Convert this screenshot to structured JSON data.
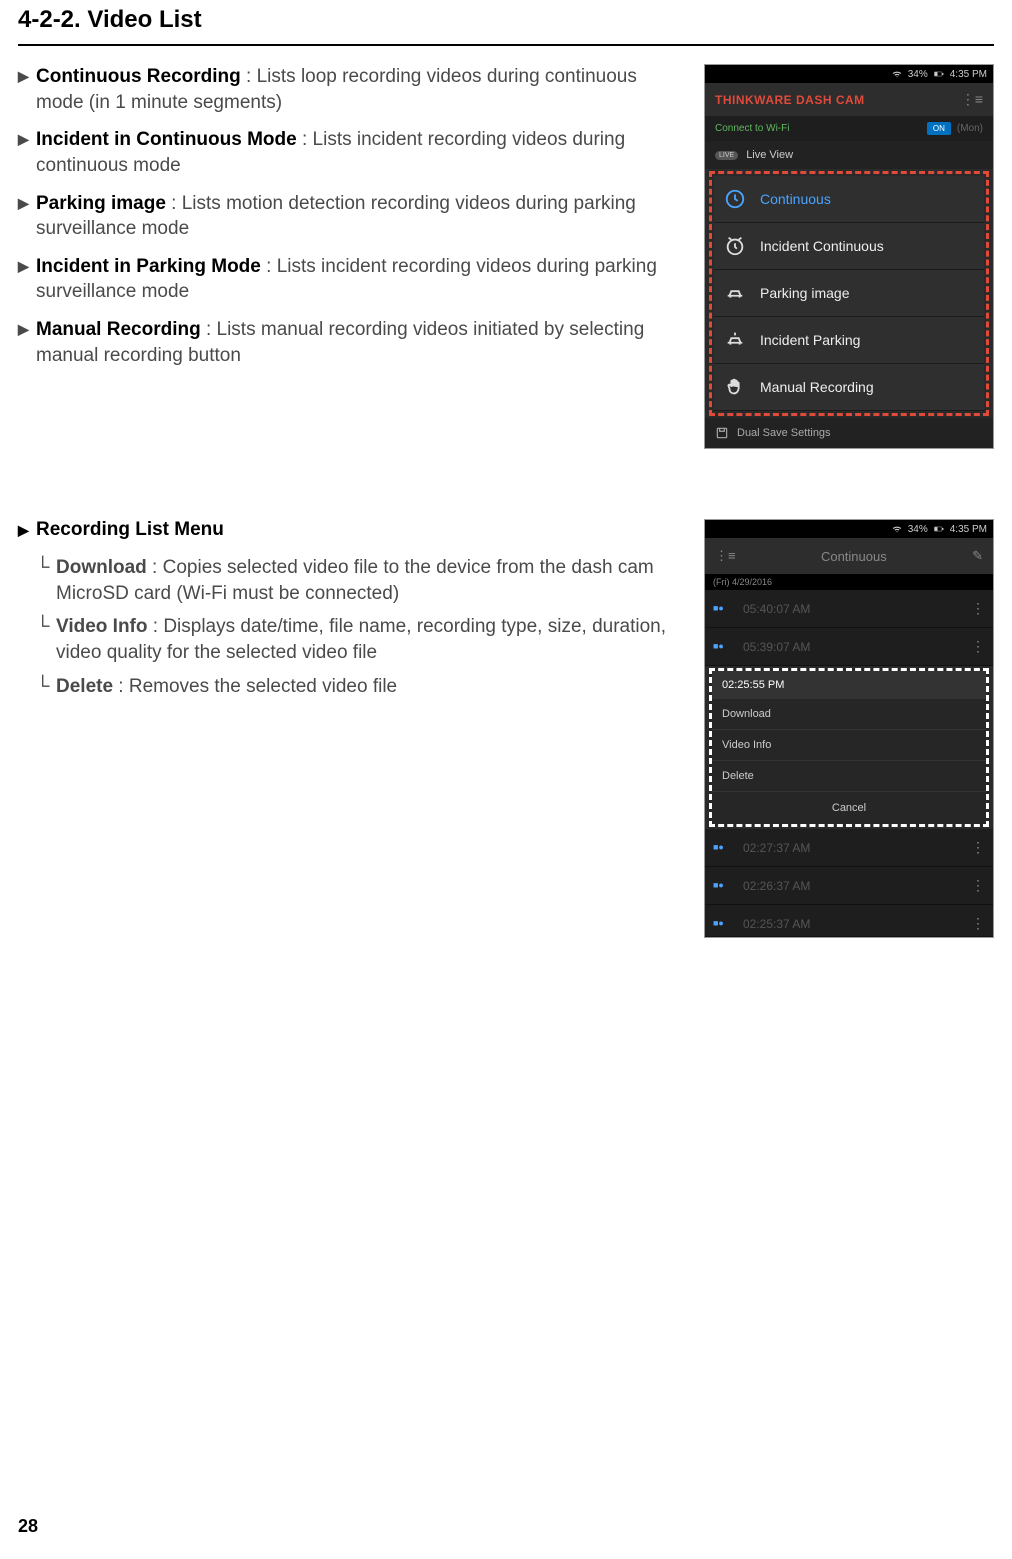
{
  "page": {
    "section_title": "4-2-2. Video List",
    "number": "28"
  },
  "list1": [
    {
      "label": "Continuous Recording",
      "desc": " : Lists loop recording videos during continuous mode (in 1 minute segments)"
    },
    {
      "label": "Incident in Continuous Mode",
      "desc": " : Lists incident recording videos during continuous mode"
    },
    {
      "label": "Parking image",
      "desc": " : Lists motion detection recording videos during parking surveillance mode"
    },
    {
      "label": "Incident in Parking Mode",
      "desc": " : Lists incident recording videos during parking surveillance mode"
    },
    {
      "label": "Manual Recording",
      "desc": " : Lists manual recording videos initiated by selecting manual recording button"
    }
  ],
  "heading2": "Recording List Menu",
  "sublist": [
    {
      "label": "Download",
      "desc": " : Copies selected video file to the device from the dash cam MicroSD card (Wi-Fi must be connected)"
    },
    {
      "label": "Video Info",
      "desc": " : Displays date/time, file name, recording type, size, duration, video quality for the selected video file"
    },
    {
      "label": "Delete",
      "desc": " : Removes the selected video file"
    }
  ],
  "phone1": {
    "status_batt": "34%",
    "status_time": "4:35 PM",
    "app_title": "THINKWARE DASH CAM",
    "wifi_label": "Connect to Wi-Fi",
    "wifi_toggle": "ON",
    "wifi_extra": "(Mon)",
    "live": "Live View",
    "menu": [
      "Continuous",
      "Incident Continuous",
      "Parking image",
      "Incident Parking",
      "Manual Recording"
    ],
    "dual": "Dual Save Settings"
  },
  "phone2": {
    "status_batt": "34%",
    "status_time": "4:35 PM",
    "header_title": "Continuous",
    "date": "(Fri) 4/29/2016",
    "rows_top": [
      "05:40:07 AM",
      "05:39:07 AM"
    ],
    "popup_title": "02:25:55 PM",
    "popup_items": [
      "Download",
      "Video Info",
      "Delete"
    ],
    "popup_cancel": "Cancel",
    "rows_bottom": [
      "02:27:37 AM",
      "02:26:37 AM",
      "02:25:37 AM"
    ]
  }
}
